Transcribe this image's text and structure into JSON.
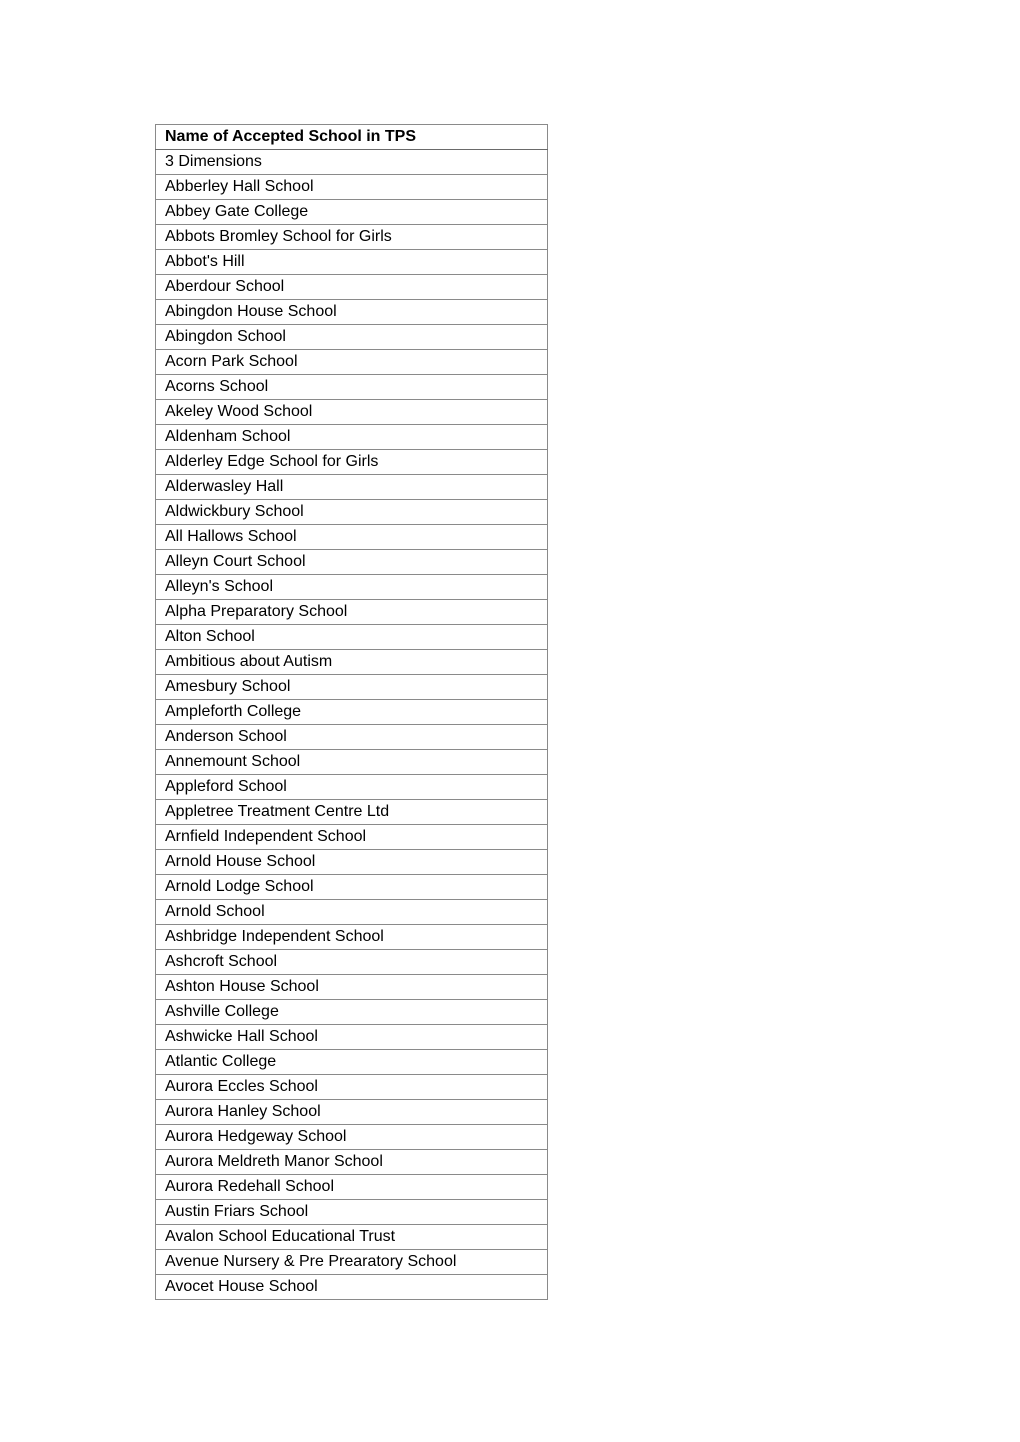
{
  "table": {
    "header": "Name of Accepted School in TPS",
    "rows": [
      "3 Dimensions",
      "Abberley Hall School",
      "Abbey Gate College",
      "Abbots Bromley School for Girls",
      "Abbot's Hill",
      "Aberdour School",
      "Abingdon House School",
      "Abingdon School",
      "Acorn Park School",
      "Acorns School",
      "Akeley Wood School",
      "Aldenham School",
      "Alderley Edge School for Girls",
      "Alderwasley Hall",
      "Aldwickbury School",
      "All Hallows School",
      "Alleyn Court School",
      "Alleyn's School",
      "Alpha Preparatory School",
      "Alton School",
      "Ambitious about Autism",
      "Amesbury School",
      "Ampleforth College",
      "Anderson School",
      "Annemount School",
      "Appleford School",
      "Appletree Treatment Centre Ltd",
      "Arnfield Independent School",
      "Arnold House School",
      "Arnold Lodge School",
      "Arnold School",
      "Ashbridge Independent School",
      "Ashcroft School",
      "Ashton House School",
      "Ashville College",
      "Ashwicke Hall School",
      "Atlantic College",
      "Aurora Eccles School",
      "Aurora Hanley School",
      "Aurora Hedgeway School",
      "Aurora Meldreth Manor School",
      "Aurora Redehall School",
      "Austin Friars School",
      "Avalon School Educational Trust",
      "Avenue Nursery & Pre Prearatory School",
      "Avocet House School"
    ]
  }
}
